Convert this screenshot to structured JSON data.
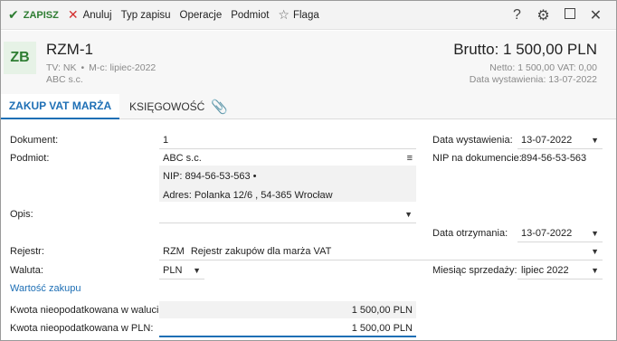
{
  "toolbar": {
    "save": "ZAPISZ",
    "cancel": "Anuluj",
    "record_type": "Typ zapisu",
    "operations": "Operacje",
    "subject": "Podmiot",
    "flag": "Flaga",
    "help": "?"
  },
  "header": {
    "badge": "ZB",
    "title": "RZM-1",
    "tv": "TV: NK",
    "mc": "M-c: lipiec-2022",
    "company": "ABC s.c.",
    "brutto": "Brutto: 1 500,00 PLN",
    "netto": "Netto: 1 500,00 VAT: 0,00",
    "issue_date": "Data wystawienia: 13-07-2022"
  },
  "tabs": {
    "active": "ZAKUP VAT MARŻA",
    "second": "KSIĘGOWOŚĆ"
  },
  "form": {
    "dokument_label": "Dokument:",
    "dokument_value": "1",
    "podmiot_label": "Podmiot:",
    "podmiot_value": "ABC s.c.",
    "nip_line": "NIP:  894-56-53-563  •",
    "adres_line": "Adres:  Polanka  12/6 , 54-365 Wrocław",
    "opis_label": "Opis:",
    "opis_value": "",
    "rejestr_label": "Rejestr:",
    "rejestr_code": "RZM",
    "rejestr_value": "Rejestr zakupów dla marża VAT",
    "waluta_label": "Waluta:",
    "waluta_value": "PLN",
    "wartosc_link": "Wartość zakupu",
    "kwota_waluta_label": "Kwota nieopodatkowana w walucie:",
    "kwota_waluta_value": "1 500,00 PLN",
    "kwota_pln_label": "Kwota nieopodatkowana w PLN:",
    "kwota_pln_value": "1 500,00 PLN",
    "data_wyst_label": "Data wystawienia:",
    "data_wyst_value": "13-07-2022",
    "nip_dok_label": "NIP na dokumencie:",
    "nip_dok_value": "894-56-53-563",
    "data_otrz_label": "Data otrzymania:",
    "data_otrz_value": "13-07-2022",
    "miesiac_label": "Miesiąc sprzedaży:",
    "miesiac_value": "lipiec 2022"
  },
  "colors": {
    "accent": "#1e6fb5",
    "save_green": "#2e7d32",
    "cancel_red": "#d32f2f"
  }
}
